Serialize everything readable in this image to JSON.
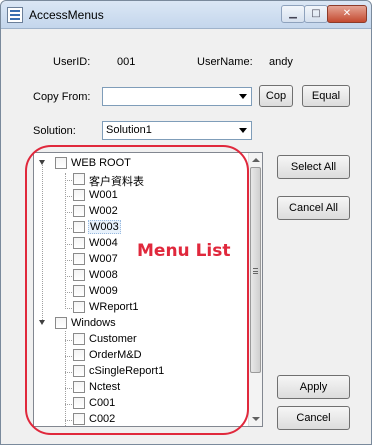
{
  "window": {
    "title": "AccessMenus",
    "close_glyph": "✕"
  },
  "user": {
    "userid_label": "UserID:",
    "userid_value": "001",
    "username_label": "UserName:",
    "username_value": "andy"
  },
  "copy_from": {
    "label": "Copy From:",
    "value": "",
    "cop_button": "Cop",
    "equal_button": "Equal"
  },
  "solution": {
    "label": "Solution:",
    "value": "Solution1"
  },
  "tree": {
    "groups": [
      {
        "label": "WEB ROOT",
        "items": [
          "客户資料表",
          "W001",
          "W002",
          "W003",
          "W004",
          "W007",
          "W008",
          "W009",
          "WReport1"
        ],
        "selected_item": "W003"
      },
      {
        "label": "Windows",
        "items": [
          "Customer",
          "OrderM&D",
          "cSingleReport1",
          "Nctest",
          "C001",
          "C002"
        ]
      }
    ]
  },
  "buttons": {
    "select_all": "Select All",
    "cancel_all": "Cancel All",
    "apply": "Apply",
    "cancel": "Cancel"
  },
  "annotation": {
    "text": "Menu List",
    "color": "#e0283c"
  }
}
